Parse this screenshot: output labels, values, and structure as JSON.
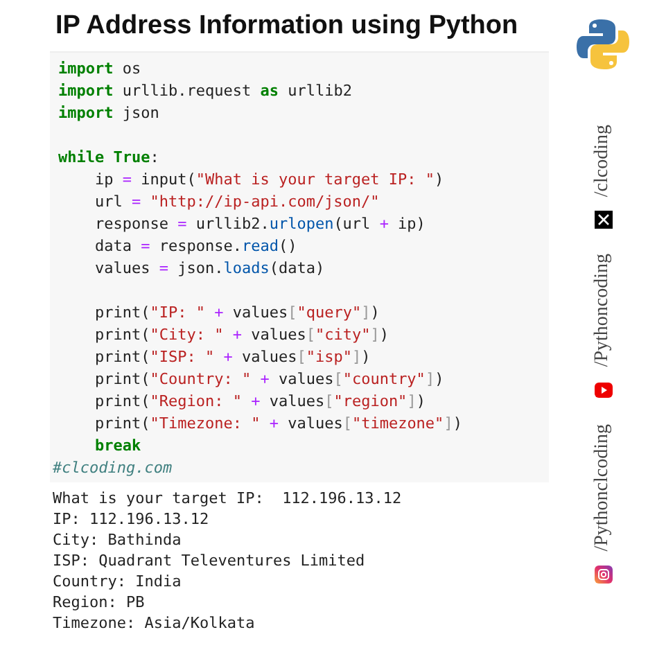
{
  "title": "IP Address Information using Python",
  "code": {
    "blocks": [
      {
        "lines": [
          {
            "indent": false,
            "tokens": [
              {
                "kind": "kw",
                "text": "import"
              },
              {
                "kind": "plain",
                "text": " os"
              }
            ]
          },
          {
            "indent": false,
            "tokens": [
              {
                "kind": "kw",
                "text": "import"
              },
              {
                "kind": "plain",
                "text": " urllib.request "
              },
              {
                "kind": "kw",
                "text": "as"
              },
              {
                "kind": "plain",
                "text": " urllib2"
              }
            ]
          },
          {
            "indent": false,
            "tokens": [
              {
                "kind": "kw",
                "text": "import"
              },
              {
                "kind": "plain",
                "text": " json"
              }
            ]
          }
        ]
      },
      {
        "lines": [
          {
            "indent": false,
            "tokens": [
              {
                "kind": "kw",
                "text": "while True"
              },
              {
                "kind": "plain",
                "text": ":"
              }
            ]
          },
          {
            "indent": true,
            "tokens": [
              {
                "kind": "plain",
                "text": "ip "
              },
              {
                "kind": "op",
                "text": "="
              },
              {
                "kind": "plain",
                "text": " input("
              },
              {
                "kind": "str",
                "text": "\"What is your target IP: \""
              },
              {
                "kind": "plain",
                "text": ")"
              }
            ]
          },
          {
            "indent": true,
            "tokens": [
              {
                "kind": "plain",
                "text": "url "
              },
              {
                "kind": "op",
                "text": "="
              },
              {
                "kind": "str",
                "text": " \"http://ip-api.com/json/\""
              }
            ]
          },
          {
            "indent": true,
            "tokens": [
              {
                "kind": "plain",
                "text": "response "
              },
              {
                "kind": "op",
                "text": "="
              },
              {
                "kind": "plain",
                "text": " urllib2."
              },
              {
                "kind": "fn",
                "text": "urlopen"
              },
              {
                "kind": "plain",
                "text": "(url "
              },
              {
                "kind": "op",
                "text": "+"
              },
              {
                "kind": "plain",
                "text": " ip)"
              }
            ]
          },
          {
            "indent": true,
            "tokens": [
              {
                "kind": "plain",
                "text": "data "
              },
              {
                "kind": "op",
                "text": "="
              },
              {
                "kind": "plain",
                "text": " response."
              },
              {
                "kind": "fn",
                "text": "read"
              },
              {
                "kind": "plain",
                "text": "()"
              }
            ]
          },
          {
            "indent": true,
            "tokens": [
              {
                "kind": "plain",
                "text": "values "
              },
              {
                "kind": "op",
                "text": "="
              },
              {
                "kind": "plain",
                "text": " json."
              },
              {
                "kind": "fn",
                "text": "loads"
              },
              {
                "kind": "plain",
                "text": "(data)"
              }
            ]
          }
        ]
      },
      {
        "lines": [
          {
            "indent": true,
            "tokens": [
              {
                "kind": "plain",
                "text": "print("
              },
              {
                "kind": "str",
                "text": "\"IP: \""
              },
              {
                "kind": "op",
                "text": " +"
              },
              {
                "kind": "plain",
                "text": " values"
              },
              {
                "kind": "br",
                "text": "["
              },
              {
                "kind": "str",
                "text": "\"query\""
              },
              {
                "kind": "br",
                "text": "]"
              },
              {
                "kind": "plain",
                "text": ")"
              }
            ]
          },
          {
            "indent": true,
            "tokens": [
              {
                "kind": "plain",
                "text": "print("
              },
              {
                "kind": "str",
                "text": "\"City: \""
              },
              {
                "kind": "op",
                "text": " +"
              },
              {
                "kind": "plain",
                "text": " values"
              },
              {
                "kind": "br",
                "text": "["
              },
              {
                "kind": "str",
                "text": "\"city\""
              },
              {
                "kind": "br",
                "text": "]"
              },
              {
                "kind": "plain",
                "text": ")"
              }
            ]
          },
          {
            "indent": true,
            "tokens": [
              {
                "kind": "plain",
                "text": "print("
              },
              {
                "kind": "str",
                "text": "\"ISP: \""
              },
              {
                "kind": "op",
                "text": " +"
              },
              {
                "kind": "plain",
                "text": " values"
              },
              {
                "kind": "br",
                "text": "["
              },
              {
                "kind": "str",
                "text": "\"isp\""
              },
              {
                "kind": "br",
                "text": "]"
              },
              {
                "kind": "plain",
                "text": ")"
              }
            ]
          },
          {
            "indent": true,
            "tokens": [
              {
                "kind": "plain",
                "text": "print("
              },
              {
                "kind": "str",
                "text": "\"Country: \""
              },
              {
                "kind": "op",
                "text": " +"
              },
              {
                "kind": "plain",
                "text": " values"
              },
              {
                "kind": "br",
                "text": "["
              },
              {
                "kind": "str",
                "text": "\"country\""
              },
              {
                "kind": "br",
                "text": "]"
              },
              {
                "kind": "plain",
                "text": ")"
              }
            ]
          },
          {
            "indent": true,
            "tokens": [
              {
                "kind": "plain",
                "text": "print("
              },
              {
                "kind": "str",
                "text": "\"Region: \""
              },
              {
                "kind": "op",
                "text": " +"
              },
              {
                "kind": "plain",
                "text": " values"
              },
              {
                "kind": "br",
                "text": "["
              },
              {
                "kind": "str",
                "text": "\"region\""
              },
              {
                "kind": "br",
                "text": "]"
              },
              {
                "kind": "plain",
                "text": ")"
              }
            ]
          },
          {
            "indent": true,
            "tokens": [
              {
                "kind": "plain",
                "text": "print("
              },
              {
                "kind": "str",
                "text": "\"Timezone: \""
              },
              {
                "kind": "op",
                "text": " +"
              },
              {
                "kind": "plain",
                "text": " values"
              },
              {
                "kind": "br",
                "text": "["
              },
              {
                "kind": "str",
                "text": "\"timezone\""
              },
              {
                "kind": "br",
                "text": "]"
              },
              {
                "kind": "plain",
                "text": ")"
              }
            ]
          },
          {
            "indent": true,
            "tokens": [
              {
                "kind": "kw",
                "text": "break"
              }
            ]
          }
        ]
      }
    ],
    "comment": "#clcoding.com"
  },
  "output": [
    "What is your target IP:  112.196.13.12",
    "IP: 112.196.13.12",
    "City: Bathinda",
    "ISP: Quadrant Televentures Limited",
    "Country: India",
    "Region: PB",
    "Timezone: Asia/Kolkata"
  ],
  "socials": [
    {
      "kind": "x",
      "handle": "/clcoding"
    },
    {
      "kind": "youtube",
      "handle": "/Pythoncoding"
    },
    {
      "kind": "instagram",
      "handle": "/Pythonclcoding"
    }
  ]
}
